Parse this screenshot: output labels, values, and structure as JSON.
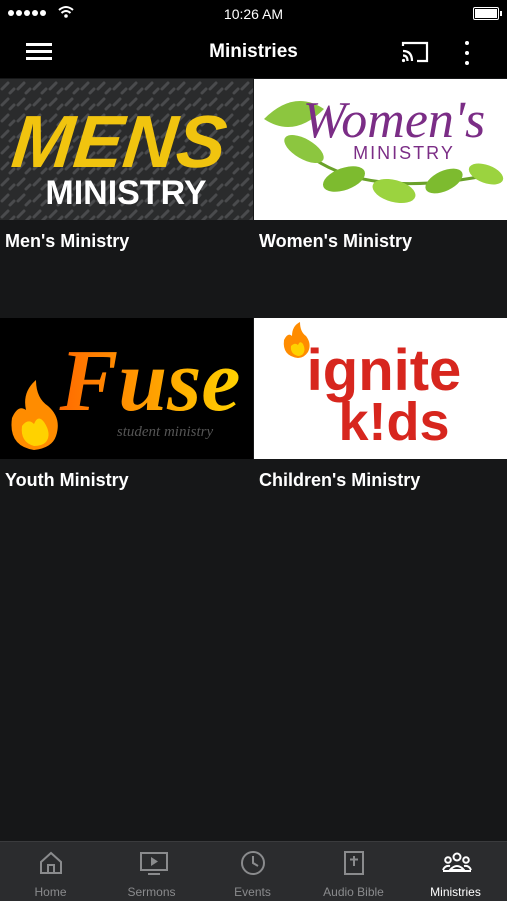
{
  "status": {
    "time": "10:26 AM"
  },
  "header": {
    "title": "Ministries"
  },
  "tiles": [
    {
      "label": "Men's Ministry",
      "art": {
        "line1": "MENS",
        "line2": "MINISTRY"
      }
    },
    {
      "label": "Women's Ministry",
      "art": {
        "line1": "Women's",
        "line2": "MINISTRY"
      }
    },
    {
      "label": "Youth Ministry",
      "art": {
        "line1": "Fuse",
        "line2": "student ministry"
      }
    },
    {
      "label": "Children's Ministry",
      "art": {
        "line1": "ignite",
        "line2": "k!ds"
      }
    }
  ],
  "tabs": [
    {
      "label": "Home",
      "icon": "home-icon",
      "active": false
    },
    {
      "label": "Sermons",
      "icon": "play-screen-icon",
      "active": false
    },
    {
      "label": "Events",
      "icon": "clock-icon",
      "active": false
    },
    {
      "label": "Audio Bible",
      "icon": "bible-icon",
      "active": false
    },
    {
      "label": "Ministries",
      "icon": "people-icon",
      "active": true
    }
  ],
  "colors": {
    "background": "#161718",
    "bar": "#000000",
    "tabbar": "#2b2c2e",
    "inactive_tab": "#8a8b8d"
  }
}
